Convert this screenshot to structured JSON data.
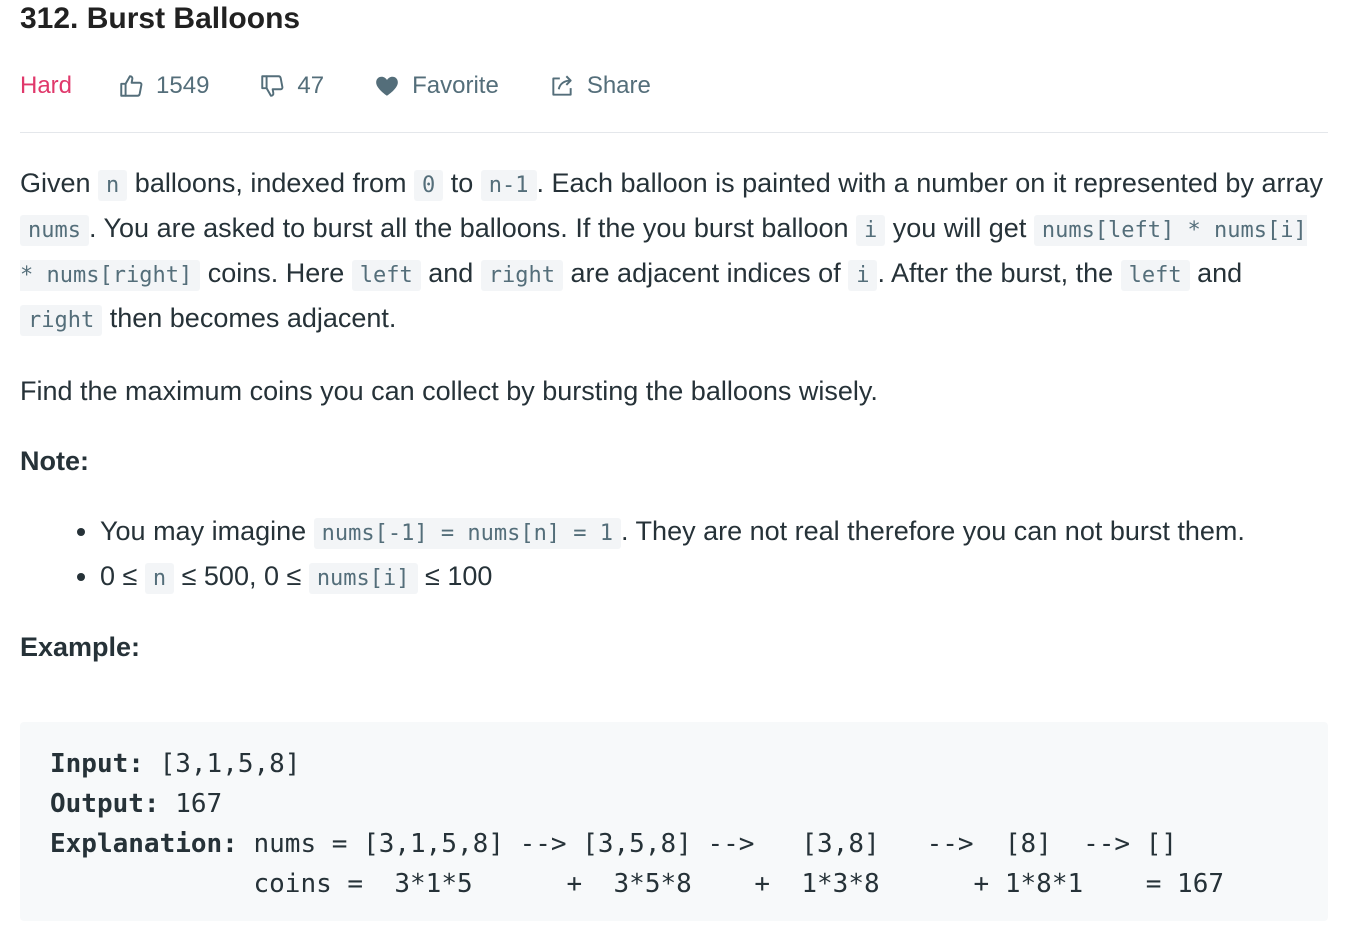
{
  "problem": {
    "title": "312. Burst Balloons",
    "difficulty": "Hard",
    "likes": "1549",
    "dislikes": "47",
    "favorite_label": "Favorite",
    "share_label": "Share"
  },
  "description": {
    "p1_a": "Given ",
    "code_n": "n",
    "p1_b": " balloons, indexed from ",
    "code_0": "0",
    "p1_c": " to ",
    "code_n1": "n-1",
    "p1_d": ". Each balloon is painted with a number on it represented by array ",
    "code_nums": "nums",
    "p1_e": ". You are asked to burst all the balloons. If the you burst balloon ",
    "code_i": "i",
    "p1_f": " you will get ",
    "code_product": "nums[left] * nums[i] * nums[right]",
    "p1_g": " coins. Here ",
    "code_left": "left",
    "p1_h": " and ",
    "code_right": "right",
    "p1_i": " are adjacent indices of ",
    "code_i2": "i",
    "p1_j": ". After the burst, the ",
    "code_left2": "left",
    "p1_k": " and ",
    "code_right2": "right",
    "p1_l": " then becomes adjacent.",
    "p2": "Find the maximum coins you can collect by bursting the balloons wisely.",
    "note_heading": "Note:",
    "note1_a": "You may imagine ",
    "note1_code": "nums[-1] = nums[n] = 1",
    "note1_b": ". They are not real therefore you can not burst them.",
    "note2_a": "0 ≤ ",
    "note2_code_n": "n",
    "note2_b": " ≤ 500, 0 ≤ ",
    "note2_code_nums": "nums[i]",
    "note2_c": " ≤ 100",
    "example_heading": "Example:"
  },
  "example": {
    "input_label": "Input:",
    "input_value": " [3,1,5,8]",
    "output_label": "Output:",
    "output_value": " 167",
    "explanation_label": "Explanation:",
    "explanation_line1": " nums = [3,1,5,8] --> [3,5,8] -->   [3,8]   -->  [8]  --> []",
    "explanation_line2": "             coins =  3*1*5      +  3*5*8    +  1*3*8      + 1*8*1    = 167"
  }
}
